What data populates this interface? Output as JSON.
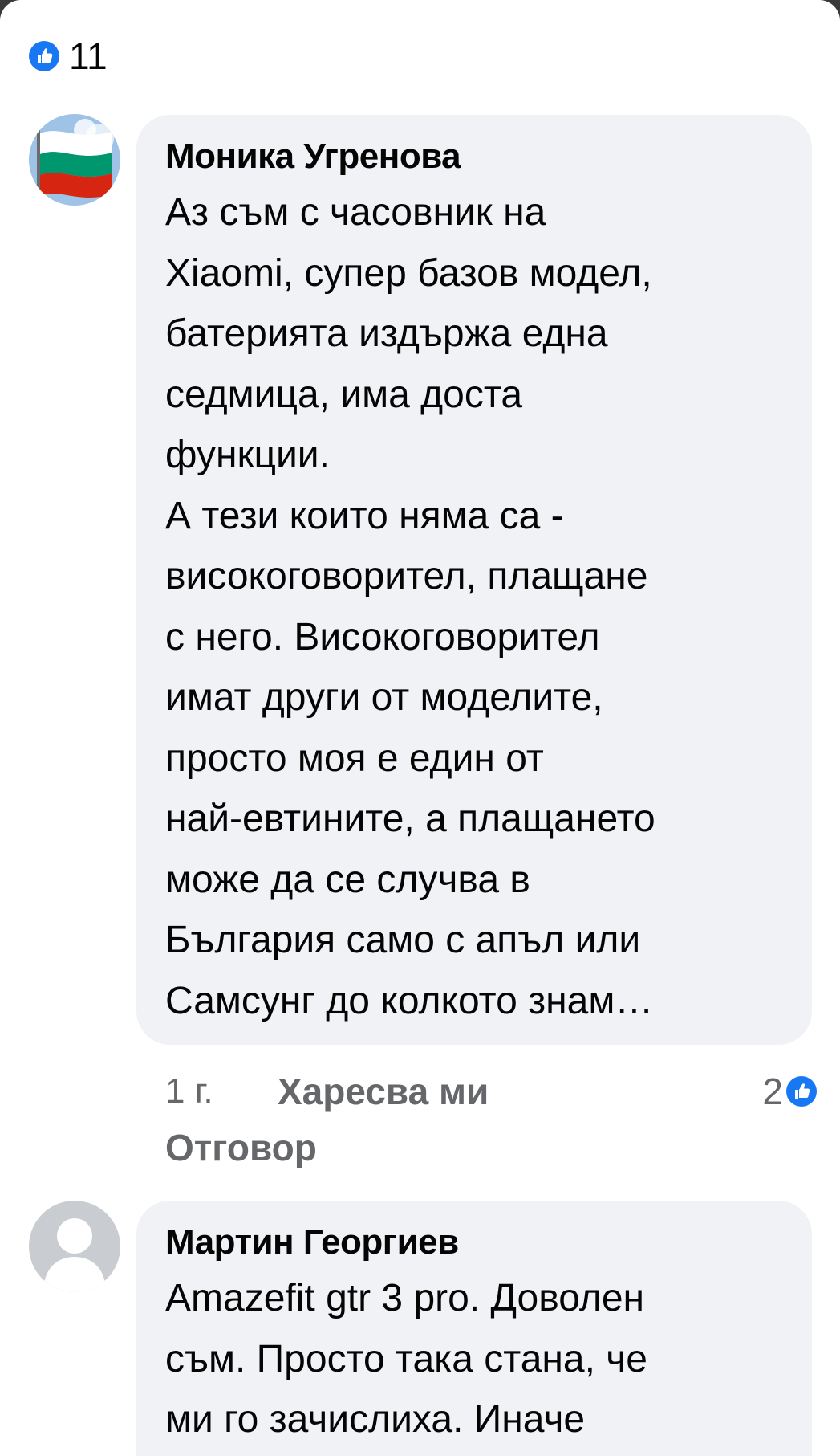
{
  "post": {
    "like_count": "11"
  },
  "comments": [
    {
      "author": "Моника Угренова",
      "text": "Аз съм с часовник на\nXiaomi, супер базов модел,\nбатерията издържа една\nседмица, има доста\nфункции.\nА тези които няма са -\nвисокоговорител, плащане\nс него. Високоговорител\nимат други от моделите,\nпросто моя е един от\nнай-евтините, а плащането\nможе да се случва в\nБългария само с апъл или\nСамсунг до колкото знам…",
      "time": "1 г.",
      "like_label": "Харесва ми",
      "reply_label": "Отговор",
      "reaction_count": "2"
    },
    {
      "author": "Мартин Георгиев",
      "text": "Amazefit gtr 3 pro. Доволен\nсъм. Просто така стана, че\nми го зачислиха. Иначе"
    }
  ],
  "colors": {
    "like_blue": "#1877f2",
    "bubble_bg": "#f0f2f5",
    "meta_gray": "#65676b",
    "flag_white": "#ffffff",
    "flag_green": "#00966e",
    "flag_red": "#d62612",
    "sky": "#9fc3e6",
    "default_avatar_bg": "#c9ccd1"
  }
}
